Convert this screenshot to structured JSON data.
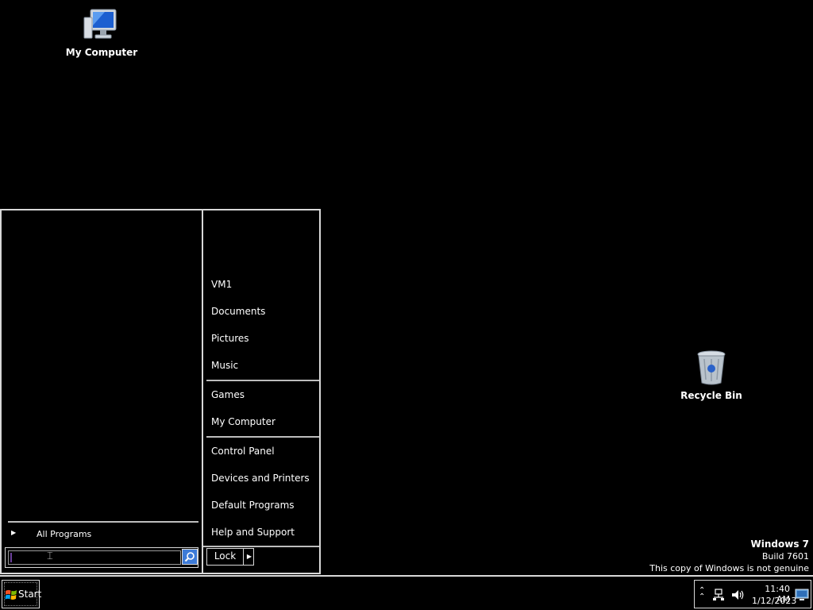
{
  "desktop": {
    "icons": [
      {
        "label": "My Computer",
        "icon": "computer-icon"
      },
      {
        "label": "Recycle Bin",
        "icon": "recycle-bin-icon"
      }
    ]
  },
  "start_menu": {
    "all_programs_label": "All Programs",
    "search": {
      "value": "",
      "placeholder": ""
    },
    "right_items": [
      "VM1",
      "Documents",
      "Pictures",
      "Music",
      "Games",
      "My Computer",
      "Control Panel",
      "Devices and Printers",
      "Default Programs",
      "Help and Support"
    ],
    "lock_label": "Lock"
  },
  "watermark": {
    "line1": "Windows 7",
    "line2": "Build 7601",
    "line3": "This copy of Windows is not genuine"
  },
  "taskbar": {
    "start_label": "Start",
    "clock": {
      "time": "11:40 AM",
      "date": "1/12/2023"
    }
  },
  "colors": {
    "background": "#000000",
    "border": "#d8d8d8",
    "search_button": "#3d7bd8"
  }
}
